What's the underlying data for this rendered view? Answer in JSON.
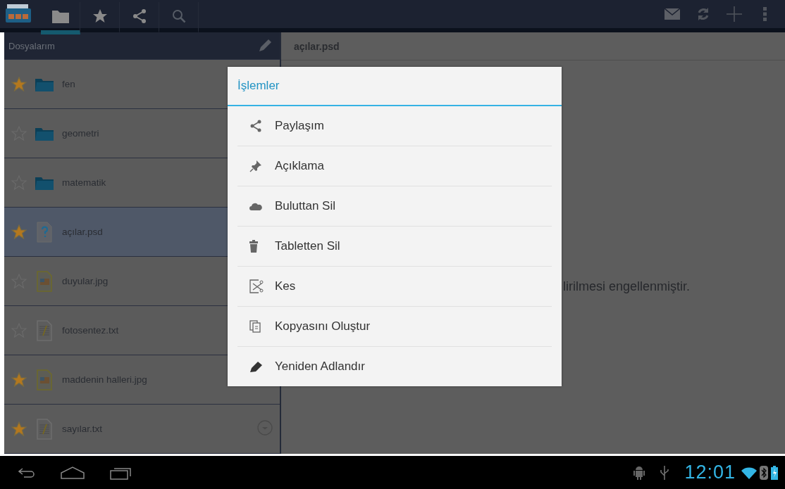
{
  "action_bar": {
    "tabs": [
      {
        "kind": "folder",
        "selected": true
      },
      {
        "kind": "star",
        "selected": false
      },
      {
        "kind": "share",
        "selected": false
      },
      {
        "kind": "search",
        "selected": false
      }
    ]
  },
  "sidebar": {
    "title": "Dosyalarım",
    "items": [
      {
        "name": "fen",
        "kind": "folder",
        "favorite": true,
        "selected": false
      },
      {
        "name": "geometri",
        "kind": "folder",
        "favorite": false,
        "selected": false
      },
      {
        "name": "matematik",
        "kind": "folder",
        "favorite": false,
        "selected": false
      },
      {
        "name": "açılar.psd",
        "kind": "unknown",
        "favorite": true,
        "selected": true
      },
      {
        "name": "duyular.jpg",
        "kind": "image",
        "favorite": false,
        "selected": false
      },
      {
        "name": "fotosentez.txt",
        "kind": "text",
        "favorite": false,
        "selected": false
      },
      {
        "name": "maddenin halleri.jpg",
        "kind": "image",
        "favorite": true,
        "selected": false
      },
      {
        "name": "sayılar.txt",
        "kind": "text",
        "favorite": true,
        "selected": false
      }
    ]
  },
  "detail": {
    "title": "açılar.psd",
    "message": "lirilmesi engellenmiştir."
  },
  "dialog": {
    "title": "İşlemler",
    "items": [
      {
        "label": "Paylaşım",
        "kind": "share"
      },
      {
        "label": "Açıklama",
        "kind": "pin"
      },
      {
        "label": "Buluttan Sil",
        "kind": "cloud"
      },
      {
        "label": "Tabletten Sil",
        "kind": "trash"
      },
      {
        "label": "Kes",
        "kind": "cut"
      },
      {
        "label": "Kopyasını Oluştur",
        "kind": "copy"
      },
      {
        "label": "Yeniden Adlandır",
        "kind": "edit"
      }
    ]
  },
  "status_bar": {
    "time": "12:01"
  }
}
